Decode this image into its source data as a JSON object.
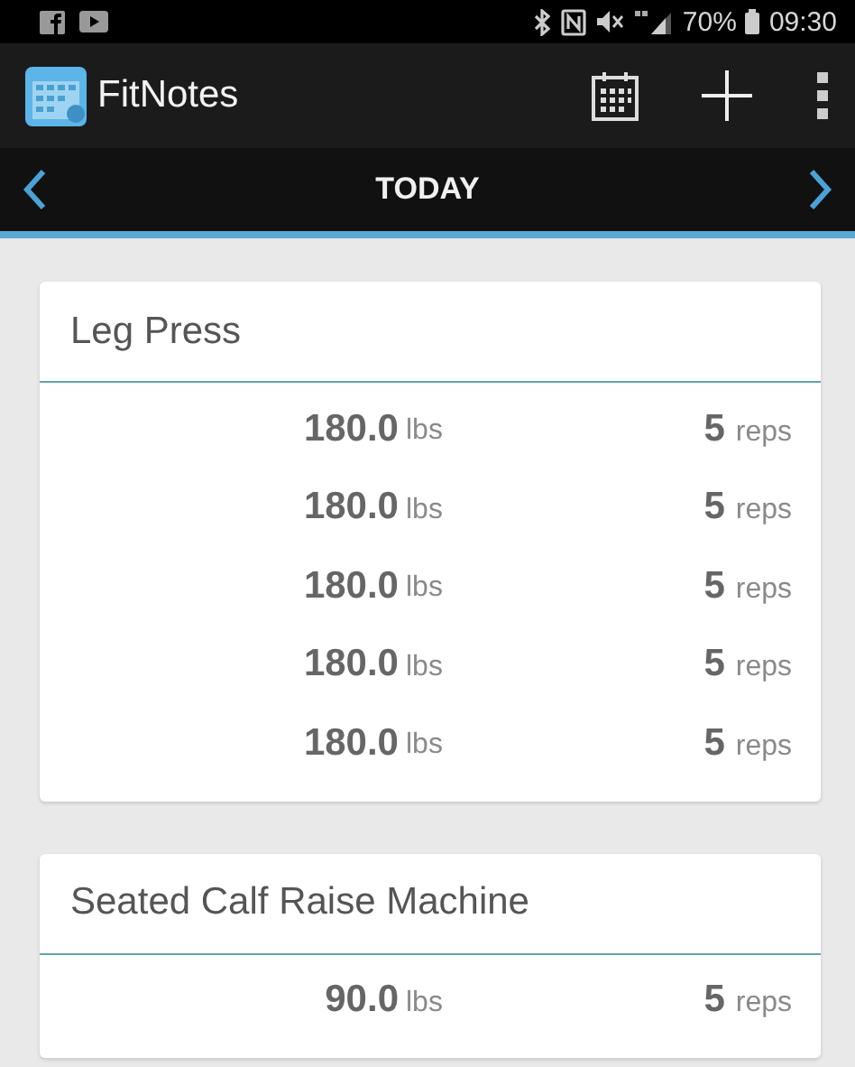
{
  "status_bar": {
    "battery": "70%",
    "time": "09:30"
  },
  "app_bar": {
    "title": "FitNotes"
  },
  "date_nav": {
    "label": "TODAY"
  },
  "exercises": [
    {
      "name": "Leg Press",
      "sets": [
        {
          "weight": "180.0",
          "weight_unit": "lbs",
          "reps": "5",
          "reps_unit": "reps"
        },
        {
          "weight": "180.0",
          "weight_unit": "lbs",
          "reps": "5",
          "reps_unit": "reps"
        },
        {
          "weight": "180.0",
          "weight_unit": "lbs",
          "reps": "5",
          "reps_unit": "reps"
        },
        {
          "weight": "180.0",
          "weight_unit": "lbs",
          "reps": "5",
          "reps_unit": "reps"
        },
        {
          "weight": "180.0",
          "weight_unit": "lbs",
          "reps": "5",
          "reps_unit": "reps"
        }
      ]
    },
    {
      "name": "Seated Calf Raise Machine",
      "sets": [
        {
          "weight": "90.0",
          "weight_unit": "lbs",
          "reps": "5",
          "reps_unit": "reps"
        }
      ]
    }
  ]
}
